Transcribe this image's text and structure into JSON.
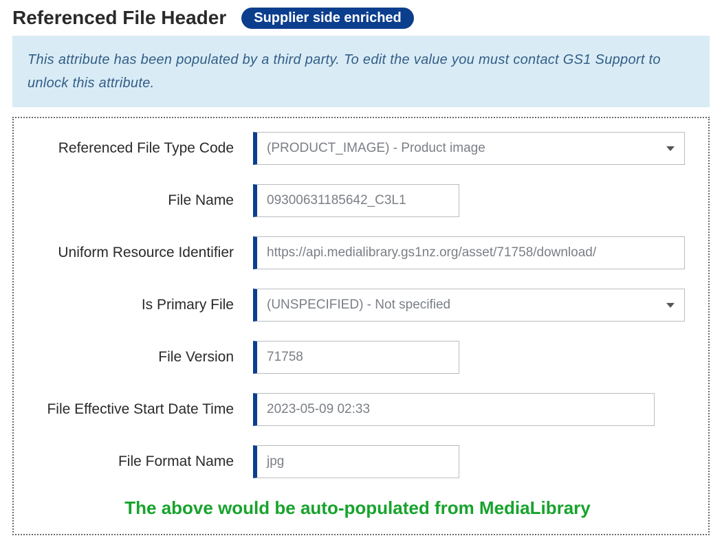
{
  "header": {
    "title": "Referenced File Header",
    "badge": "Supplier side enriched"
  },
  "notice": "This attribute has been populated by a third party. To edit the value you must contact GS1 Support to unlock this attribute.",
  "fields": {
    "fileTypeCode": {
      "label": "Referenced File Type Code",
      "value": "(PRODUCT_IMAGE) - Product image"
    },
    "fileName": {
      "label": "File Name",
      "value": "09300631185642_C3L1"
    },
    "uri": {
      "label": "Uniform Resource Identifier",
      "value": "https://api.medialibrary.gs1nz.org/asset/71758/download/"
    },
    "isPrimary": {
      "label": "Is Primary File",
      "value": "(UNSPECIFIED) - Not specified"
    },
    "fileVersion": {
      "label": "File Version",
      "value": "71758"
    },
    "startDateTime": {
      "label": "File Effective Start Date Time",
      "value": "2023-05-09 02:33"
    },
    "formatName": {
      "label": "File Format Name",
      "value": "jpg"
    }
  },
  "footnote": "The above would be auto-populated from MediaLibrary"
}
